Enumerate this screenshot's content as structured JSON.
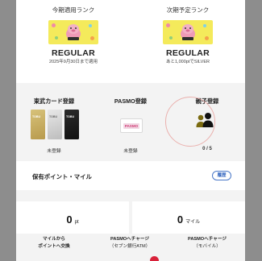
{
  "rank": {
    "current": {
      "title": "今期適用ランク",
      "name": "REGULAR",
      "note": "2025年9月30日まで適用"
    },
    "next": {
      "title": "次期予定ランク",
      "name": "REGULAR",
      "note": "あと1,000ptでSILVER"
    }
  },
  "registration": {
    "tobu_card": {
      "title": "東武カード登録",
      "status": "未登録",
      "card_labels": [
        "TOBU",
        "TOBU",
        "TOBU"
      ]
    },
    "pasmo": {
      "title": "PASMO登録",
      "status": "未登録",
      "logo_text": "PASMO"
    },
    "family": {
      "title": "親子登録",
      "count": "0 / 5"
    }
  },
  "points": {
    "title": "保有ポイント・マイル",
    "history_label": "履歴",
    "point_value": "0",
    "point_unit": "pt",
    "mile_value": "0",
    "mile_unit": "マイル",
    "actions": [
      {
        "line1": "マイルから",
        "line2": "ポイントへ交換"
      },
      {
        "line1": "PASMOへチャージ",
        "line2": "（セブン銀行ATM）"
      },
      {
        "line1": "PASMOへチャージ",
        "line2": "（モバイル）"
      }
    ]
  },
  "colors": {
    "rank_card_yellow": "#f4ea5b",
    "ring_pink": "#eab0ad",
    "link_blue": "#3466bf",
    "badge_red": "#d8223a",
    "family_icon_olive": "#7a6a10"
  }
}
